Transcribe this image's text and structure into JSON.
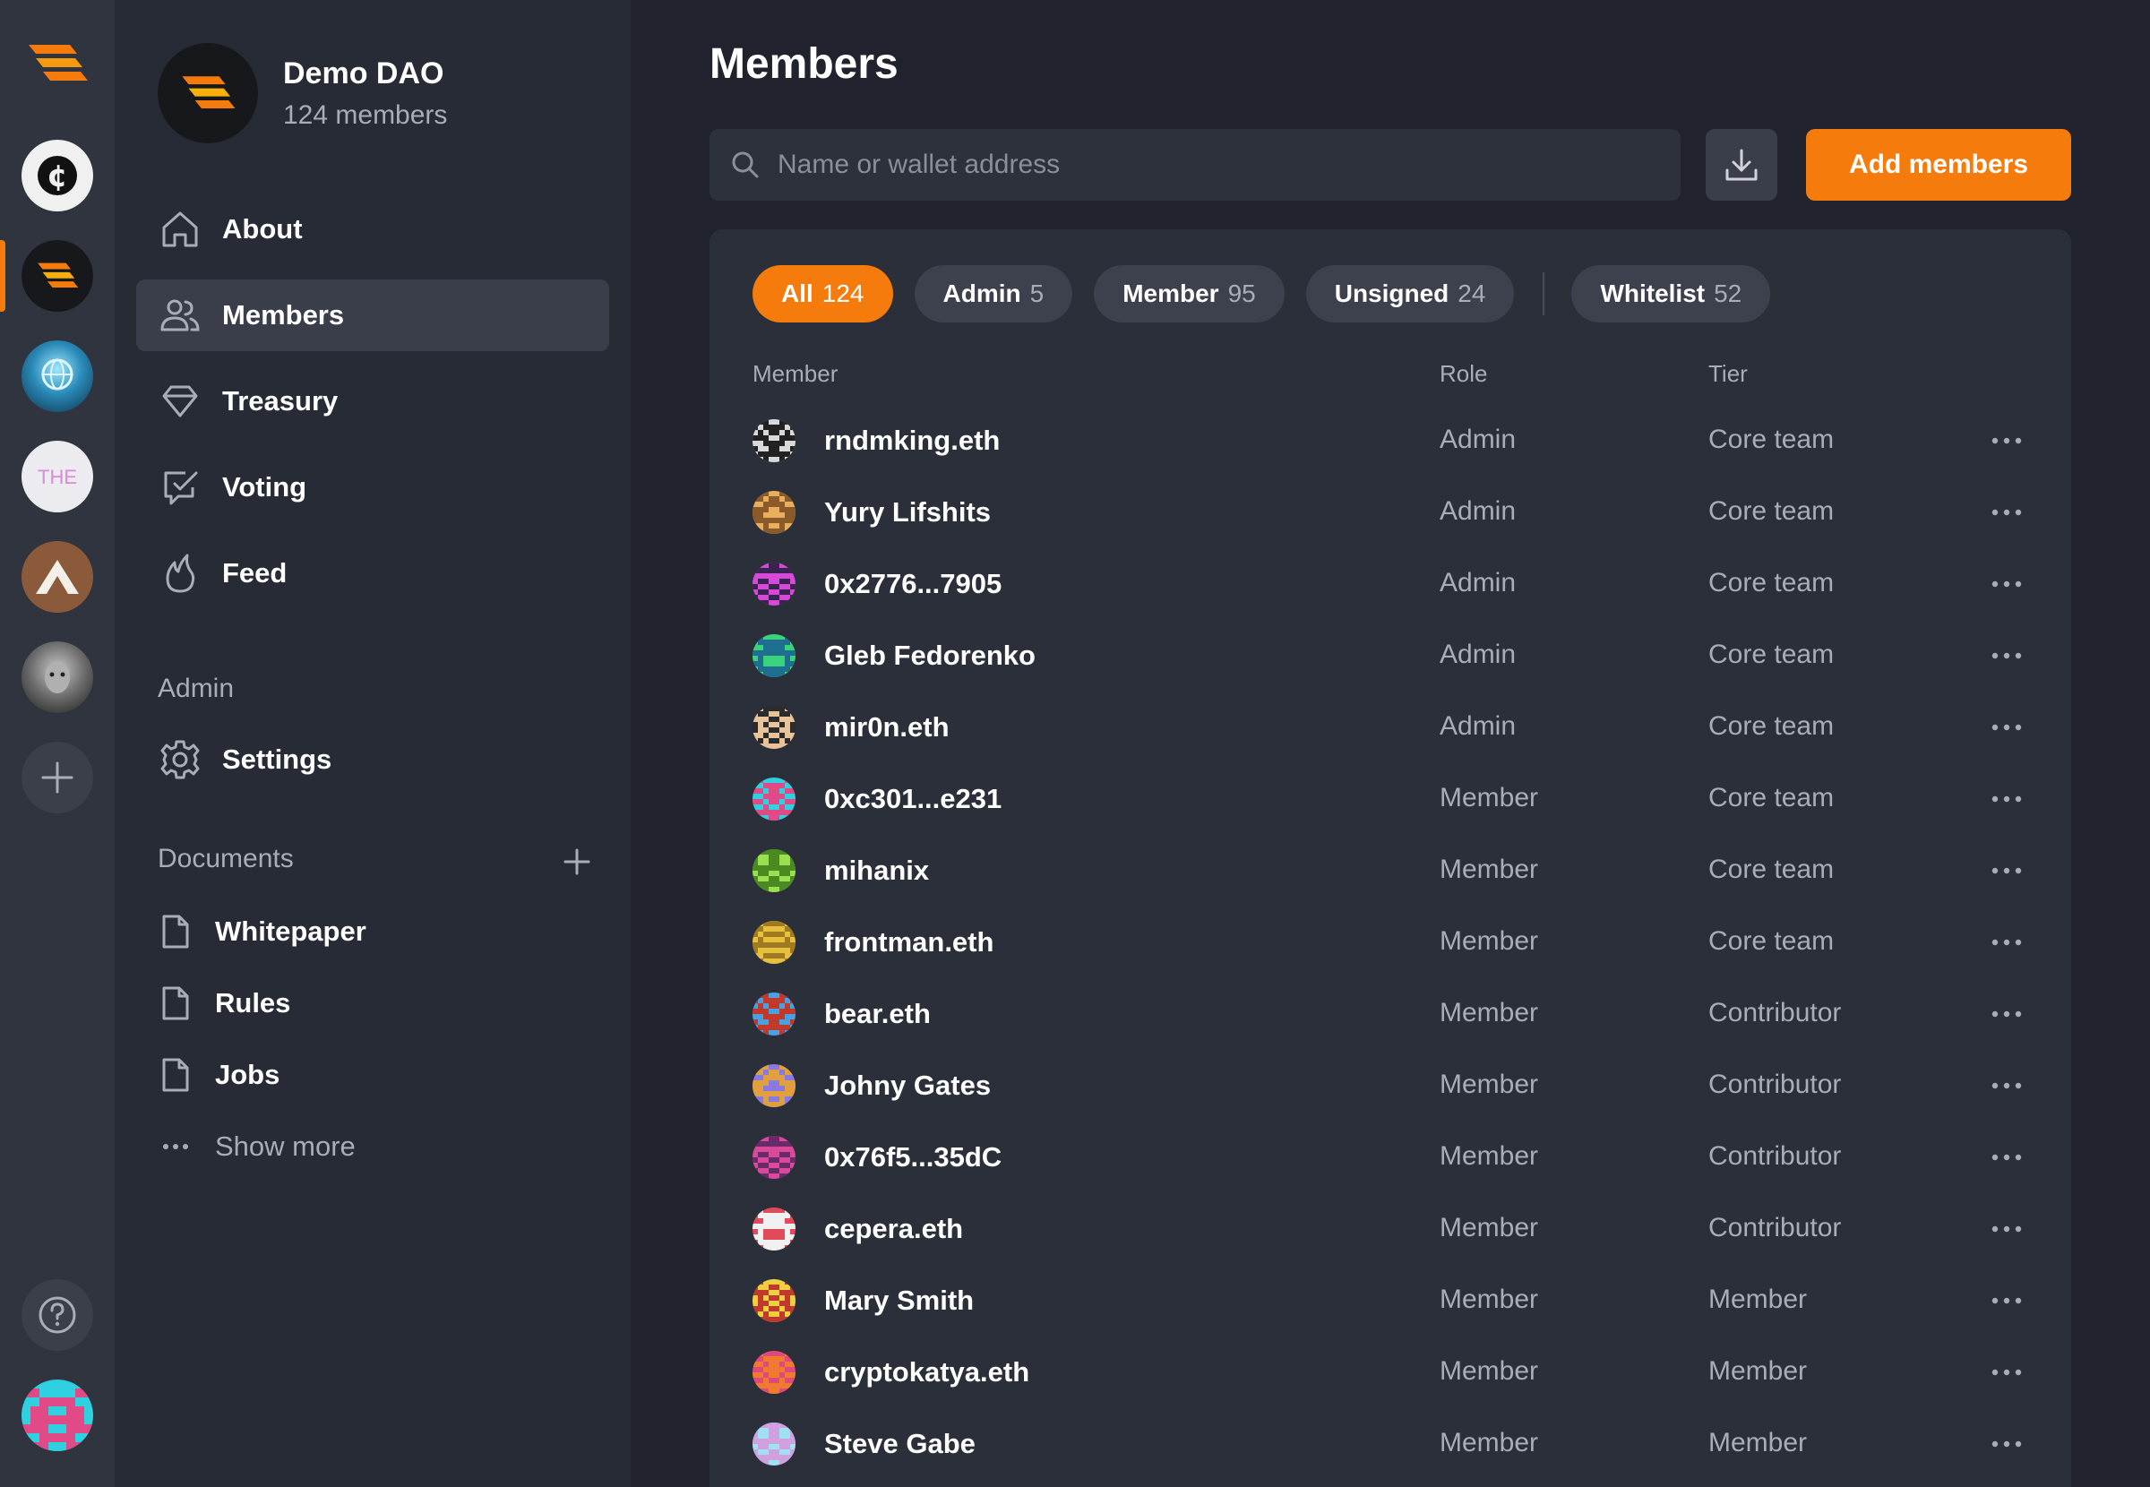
{
  "dao": {
    "name": "Demo DAO",
    "member_count": "124 members"
  },
  "rail": {
    "spaces": [
      {
        "icon": "cent-coin-icon"
      },
      {
        "icon": "demo-dao-logo-icon",
        "active": true
      },
      {
        "icon": "globe-space-icon"
      },
      {
        "icon": "the-space-icon",
        "text": "THE"
      },
      {
        "icon": "peak-space-icon"
      },
      {
        "icon": "portrait-space-icon"
      }
    ],
    "add_space": "plus-icon",
    "help": "help-icon"
  },
  "nav": {
    "items": [
      {
        "label": "About",
        "icon": "home-icon"
      },
      {
        "label": "Members",
        "icon": "users-icon",
        "active": true
      },
      {
        "label": "Treasury",
        "icon": "diamond-icon"
      },
      {
        "label": "Voting",
        "icon": "vote-check-icon"
      },
      {
        "label": "Feed",
        "icon": "flame-icon"
      }
    ],
    "admin_title": "Admin",
    "settings_label": "Settings",
    "documents_title": "Documents",
    "documents": [
      {
        "label": "Whitepaper"
      },
      {
        "label": "Rules"
      },
      {
        "label": "Jobs"
      }
    ],
    "show_more": "Show more"
  },
  "main": {
    "title": "Members",
    "search_placeholder": "Name or wallet address",
    "add_button": "Add members",
    "filters": [
      {
        "name": "All",
        "count": "124",
        "active": true
      },
      {
        "name": "Admin",
        "count": "5"
      },
      {
        "name": "Member",
        "count": "95"
      },
      {
        "name": "Unsigned",
        "count": "24"
      },
      {
        "name": "Whitelist",
        "count": "52"
      }
    ],
    "columns": {
      "member": "Member",
      "role": "Role",
      "tier": "Tier"
    },
    "members": [
      {
        "name": "rndmking.eth",
        "role": "Admin",
        "tier": "Core team",
        "colors": [
          "#d9d9d9",
          "#222222"
        ]
      },
      {
        "name": "Yury Lifshits",
        "role": "Admin",
        "tier": "Core team",
        "colors": [
          "#e8b05c",
          "#8a5a2a"
        ]
      },
      {
        "name": "0x2776...7905",
        "role": "Admin",
        "tier": "Core team",
        "colors": [
          "#d54bd8",
          "#3a2350"
        ]
      },
      {
        "name": "Gleb Fedorenko",
        "role": "Admin",
        "tier": "Core team",
        "colors": [
          "#3ad27c",
          "#1e6f8f"
        ]
      },
      {
        "name": "mir0n.eth",
        "role": "Admin",
        "tier": "Core team",
        "colors": [
          "#2b2b2b",
          "#e8c49a"
        ]
      },
      {
        "name": "0xc301...e231",
        "role": "Member",
        "tier": "Core team",
        "colors": [
          "#2fd0e0",
          "#e04a86"
        ]
      },
      {
        "name": "mihanix",
        "role": "Member",
        "tier": "Core team",
        "colors": [
          "#9be050",
          "#4a8a20"
        ]
      },
      {
        "name": "frontman.eth",
        "role": "Member",
        "tier": "Core team",
        "colors": [
          "#e8c040",
          "#a07a20"
        ]
      },
      {
        "name": "bear.eth",
        "role": "Member",
        "tier": "Contributor",
        "colors": [
          "#4aa0e0",
          "#c0392b"
        ]
      },
      {
        "name": "Johny Gates",
        "role": "Member",
        "tier": "Contributor",
        "colors": [
          "#8a7ae0",
          "#e0a040"
        ]
      },
      {
        "name": "0x76f5...35dC",
        "role": "Member",
        "tier": "Contributor",
        "colors": [
          "#d84a9a",
          "#6a2a6a"
        ]
      },
      {
        "name": "cepera.eth",
        "role": "Member",
        "tier": "Contributor",
        "colors": [
          "#e04a5a",
          "#f0f0f0"
        ]
      },
      {
        "name": "Mary Smith",
        "role": "Member",
        "tier": "Member",
        "colors": [
          "#f0d040",
          "#c0392b"
        ]
      },
      {
        "name": "cryptokatya.eth",
        "role": "Member",
        "tier": "Member",
        "colors": [
          "#e04a7a",
          "#f07a30"
        ]
      },
      {
        "name": "Steve Gabe",
        "role": "Member",
        "tier": "Member",
        "colors": [
          "#a0e0f0",
          "#d0a0e0"
        ]
      }
    ]
  },
  "colors": {
    "accent": "#f57c0c",
    "background": "#20232d",
    "sidebar": "#272b35",
    "rail": "#30343f",
    "muted_text": "#a9adb8"
  }
}
